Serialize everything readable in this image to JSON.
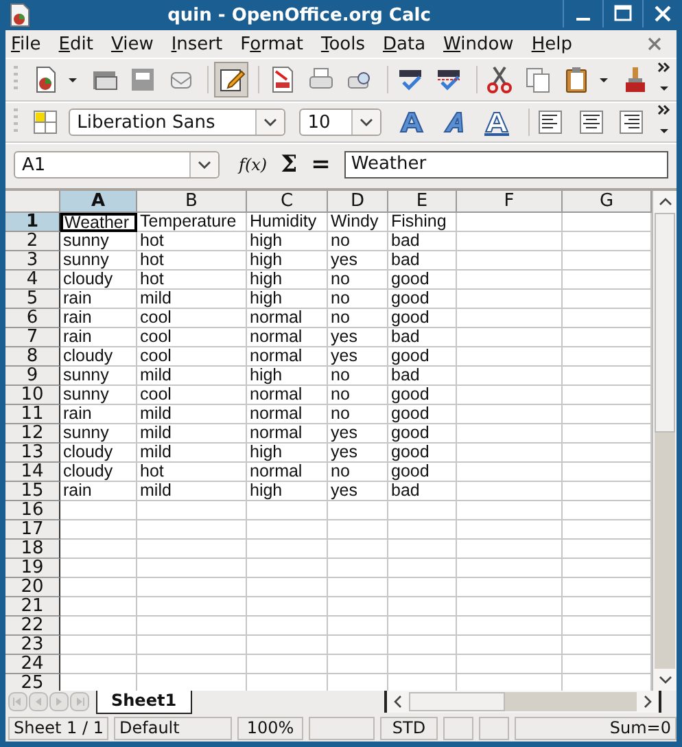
{
  "window": {
    "title": "quin - OpenOffice.org Calc"
  },
  "menu": [
    {
      "key": "F",
      "after": "ile"
    },
    {
      "key": "E",
      "after": "dit"
    },
    {
      "key": "V",
      "after": "iew"
    },
    {
      "key": "I",
      "after": "nsert"
    },
    {
      "before": "F",
      "key": "o",
      "after": "rmat"
    },
    {
      "key": "T",
      "after": "ools"
    },
    {
      "key": "D",
      "after": "ata"
    },
    {
      "key": "W",
      "after": "indow"
    },
    {
      "key": "H",
      "after": "elp"
    }
  ],
  "toolbar": [
    {
      "kind": "new"
    },
    {
      "kind": "drop"
    },
    {
      "kind": "open"
    },
    {
      "kind": "save"
    },
    {
      "kind": "mail"
    },
    {
      "kind": "sep"
    },
    {
      "kind": "edit",
      "on": true
    },
    {
      "kind": "sep"
    },
    {
      "kind": "pdf"
    },
    {
      "kind": "print"
    },
    {
      "kind": "preview"
    },
    {
      "kind": "sep"
    },
    {
      "kind": "spell"
    },
    {
      "kind": "autospell"
    },
    {
      "kind": "sep"
    },
    {
      "kind": "cut"
    },
    {
      "kind": "copy"
    },
    {
      "kind": "paste"
    },
    {
      "kind": "drop"
    },
    {
      "kind": "brush"
    }
  ],
  "format_bar": {
    "font": "Liberation Sans",
    "size": "10",
    "buttons": [
      {
        "kind": "bold"
      },
      {
        "kind": "italic"
      },
      {
        "kind": "underline"
      },
      {
        "kind": "sep"
      },
      {
        "kind": "left"
      },
      {
        "kind": "center"
      },
      {
        "kind": "right"
      }
    ]
  },
  "formula_bar": {
    "name_box": "A1",
    "symbols": [
      "f(x)",
      "Σ",
      "="
    ],
    "value": "Weather"
  },
  "columns": [
    {
      "label": "A",
      "selected": true
    },
    {
      "label": "B",
      "selected": false
    },
    {
      "label": "C",
      "selected": false
    },
    {
      "label": "D",
      "selected": false
    },
    {
      "label": "E",
      "selected": false
    },
    {
      "label": "F",
      "selected": false
    },
    {
      "label": "G",
      "selected": false
    }
  ],
  "rows": [
    {
      "number": "1",
      "selected": true,
      "cells": [
        "Weather",
        "Temperature",
        "Humidity",
        "Windy",
        "Fishing"
      ]
    },
    {
      "number": "2",
      "selected": false,
      "cells": [
        "sunny",
        "hot",
        "high",
        "no",
        "bad"
      ]
    },
    {
      "number": "3",
      "selected": false,
      "cells": [
        "sunny",
        "hot",
        "high",
        "yes",
        "bad"
      ]
    },
    {
      "number": "4",
      "selected": false,
      "cells": [
        "cloudy",
        "hot",
        "high",
        "no",
        "good"
      ]
    },
    {
      "number": "5",
      "selected": false,
      "cells": [
        "rain",
        "mild",
        "high",
        "no",
        "good"
      ]
    },
    {
      "number": "6",
      "selected": false,
      "cells": [
        "rain",
        "cool",
        "normal",
        "no",
        "good"
      ]
    },
    {
      "number": "7",
      "selected": false,
      "cells": [
        "rain",
        "cool",
        "normal",
        "yes",
        "bad"
      ]
    },
    {
      "number": "8",
      "selected": false,
      "cells": [
        "cloudy",
        "cool",
        "normal",
        "yes",
        "good"
      ]
    },
    {
      "number": "9",
      "selected": false,
      "cells": [
        "sunny",
        "mild",
        "high",
        "no",
        "bad"
      ]
    },
    {
      "number": "10",
      "selected": false,
      "cells": [
        "sunny",
        "cool",
        "normal",
        "no",
        "good"
      ]
    },
    {
      "number": "11",
      "selected": false,
      "cells": [
        "rain",
        "mild",
        "normal",
        "no",
        "good"
      ]
    },
    {
      "number": "12",
      "selected": false,
      "cells": [
        "sunny",
        "mild",
        "normal",
        "yes",
        "good"
      ]
    },
    {
      "number": "13",
      "selected": false,
      "cells": [
        "cloudy",
        "mild",
        "high",
        "yes",
        "good"
      ]
    },
    {
      "number": "14",
      "selected": false,
      "cells": [
        "cloudy",
        "hot",
        "normal",
        "no",
        "good"
      ]
    },
    {
      "number": "15",
      "selected": false,
      "cells": [
        "rain",
        "mild",
        "high",
        "yes",
        "bad"
      ]
    },
    {
      "number": "16",
      "selected": false
    },
    {
      "number": "17",
      "selected": false
    },
    {
      "number": "18",
      "selected": false
    },
    {
      "number": "19",
      "selected": false
    },
    {
      "number": "20",
      "selected": false
    },
    {
      "number": "21",
      "selected": false
    },
    {
      "number": "22",
      "selected": false
    },
    {
      "number": "23",
      "selected": false
    },
    {
      "number": "24",
      "selected": false
    },
    {
      "number": "25",
      "selected": false
    }
  ],
  "sheet_tabs": [
    {
      "label": "Sheet1",
      "selected": true
    }
  ],
  "status_bar": [
    {
      "kind": "text",
      "text": "Sheet 1 / 1"
    },
    {
      "kind": "text",
      "text": "Default"
    },
    {
      "kind": "center",
      "text": "100%"
    },
    {
      "kind": "blank"
    },
    {
      "kind": "center",
      "text": "STD"
    },
    {
      "kind": "blank"
    },
    {
      "kind": "blank"
    },
    {
      "kind": "right",
      "text": "Sum=0"
    }
  ]
}
